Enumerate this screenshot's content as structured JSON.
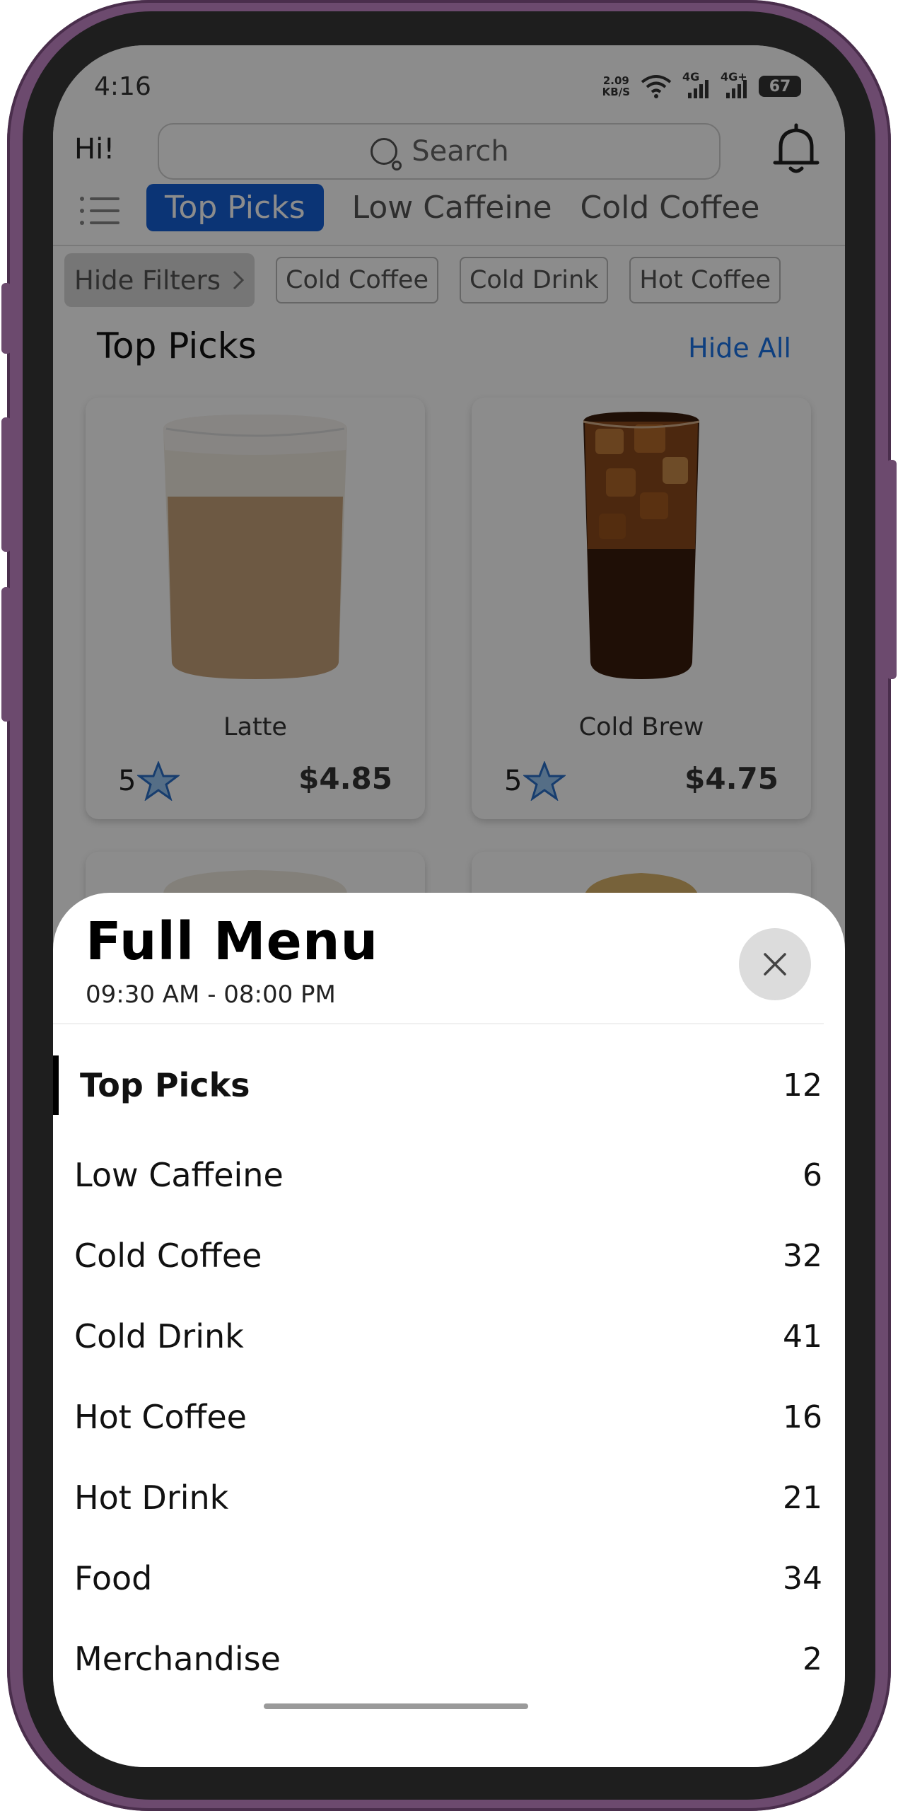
{
  "status_bar": {
    "time": "4:16",
    "net_speed_top": "2.09",
    "net_speed_bottom": "KB/S",
    "signal1_label": "4G",
    "signal2_label": "4G+",
    "battery": "67"
  },
  "header": {
    "greeting": "Hi!",
    "search_placeholder": "Search"
  },
  "tabs": [
    {
      "label": "Top Picks",
      "active": true
    },
    {
      "label": "Low Caffeine",
      "active": false
    },
    {
      "label": "Cold Coffee",
      "active": false
    }
  ],
  "filters": {
    "toggle_label": "Hide Filters",
    "chips": [
      "Cold Coffee",
      "Cold Drink",
      "Hot Coffee"
    ]
  },
  "section": {
    "title": "Top Picks",
    "hide_all_label": "Hide All"
  },
  "products": [
    {
      "name": "Latte",
      "rating": "5",
      "price": "$4.85"
    },
    {
      "name": "Cold Brew",
      "rating": "5",
      "price": "$4.75"
    }
  ],
  "sheet": {
    "title": "Full Menu",
    "hours": "09:30 AM - 08:00 PM",
    "categories": [
      {
        "name": "Top Picks",
        "count": "12",
        "active": true
      },
      {
        "name": "Low Caffeine",
        "count": "6"
      },
      {
        "name": "Cold Coffee",
        "count": "32"
      },
      {
        "name": "Cold Drink",
        "count": "41"
      },
      {
        "name": "Hot Coffee",
        "count": "16"
      },
      {
        "name": "Hot Drink",
        "count": "21"
      },
      {
        "name": "Food",
        "count": "34"
      },
      {
        "name": "Merchandise",
        "count": "2"
      }
    ]
  },
  "colors": {
    "accent_blue": "#1560d6",
    "link_blue": "#1a73e8",
    "phone_frame": "#6c4a6e"
  },
  "icons": {
    "search": "search-icon",
    "bell": "bell-icon",
    "menu": "menu-list-icon",
    "close": "close-icon",
    "star": "star-icon",
    "chevron": "chevron-right-icon"
  }
}
